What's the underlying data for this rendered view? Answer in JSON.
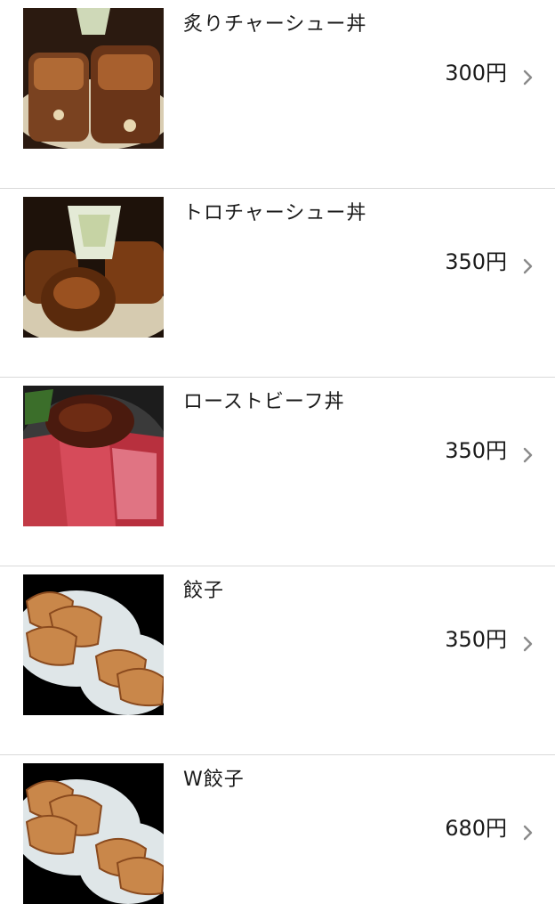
{
  "menu": {
    "items": [
      {
        "name": "炙りチャーシュー丼",
        "price": "300円",
        "image": "aburi-chashu-don-photo"
      },
      {
        "name": "トロチャーシュー丼",
        "price": "350円",
        "image": "toro-chashu-don-photo"
      },
      {
        "name": "ローストビーフ丼",
        "price": "350円",
        "image": "roast-beef-don-photo"
      },
      {
        "name": "餃子",
        "price": "350円",
        "image": "gyoza-photo"
      },
      {
        "name": "W餃子",
        "price": "680円",
        "image": "double-gyoza-photo"
      }
    ]
  },
  "icons": {
    "chevron": "chevron-right-icon"
  },
  "colors": {
    "divider": "#d9d9d9",
    "text": "#1a1a1a",
    "chevron": "#8a8a8a"
  }
}
